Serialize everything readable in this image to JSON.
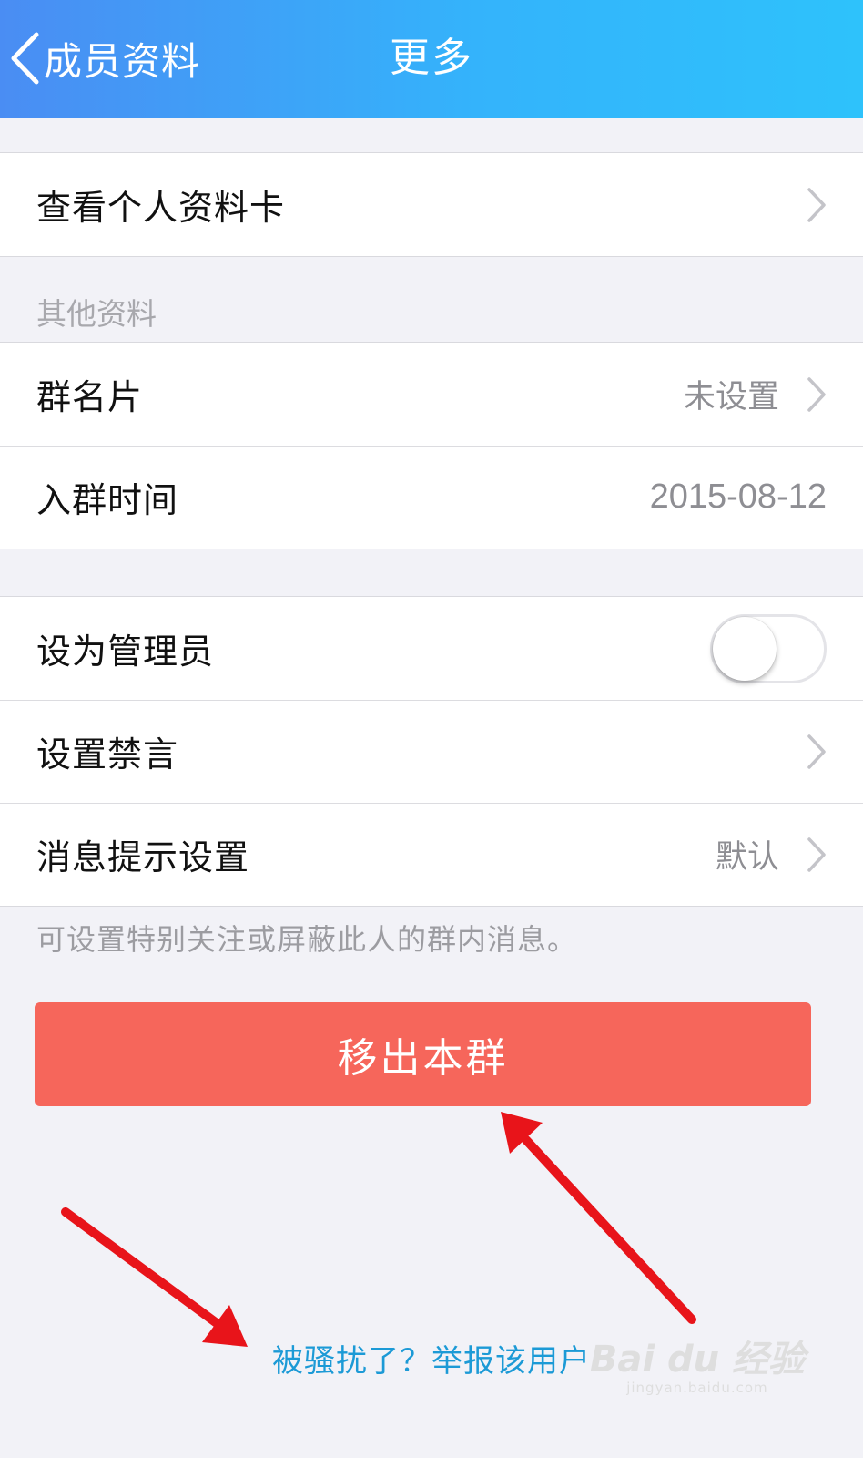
{
  "nav": {
    "back_label": "成员资料",
    "title": "更多"
  },
  "card_row": {
    "label": "查看个人资料卡"
  },
  "other_info": {
    "header": "其他资料",
    "rows": [
      {
        "label": "群名片",
        "value": "未设置"
      },
      {
        "label": "入群时间",
        "value": "2015-08-12"
      }
    ]
  },
  "admin": {
    "set_admin_label": "设为管理员",
    "set_admin_on": false,
    "mute_label": "设置禁言",
    "notify_label": "消息提示设置",
    "notify_value": "默认",
    "footnote": "可设置特别关注或屏蔽此人的群内消息。"
  },
  "remove_button": "移出本群",
  "report_link": "被骚扰了？举报该用户",
  "watermark": {
    "logo": "Bai du 经验",
    "url": "jingyan.baidu.com"
  },
  "colors": {
    "nav_gradient_start": "#4a8df3",
    "nav_gradient_end": "#2ec2fb",
    "danger": "#f6665b",
    "link": "#1c9ad6",
    "annotation_arrow": "#e8141a"
  }
}
